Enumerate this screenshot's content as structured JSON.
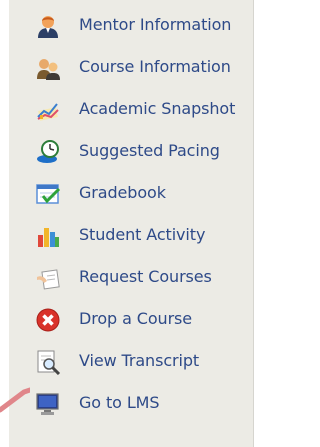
{
  "menu": {
    "items": [
      {
        "label": "Mentor Information",
        "icon": "mentor-person-icon"
      },
      {
        "label": "Course Information",
        "icon": "course-people-icon"
      },
      {
        "label": "Academic Snapshot",
        "icon": "snapshot-chart-icon"
      },
      {
        "label": "Suggested Pacing",
        "icon": "pacing-clock-icon"
      },
      {
        "label": "Gradebook",
        "icon": "gradebook-check-icon"
      },
      {
        "label": "Student Activity",
        "icon": "activity-bar-chart-icon"
      },
      {
        "label": "Request Courses",
        "icon": "request-hand-icon"
      },
      {
        "label": "Drop a Course",
        "icon": "drop-x-icon"
      },
      {
        "label": "View Transcript",
        "icon": "transcript-magnifier-icon"
      },
      {
        "label": "Go to LMS",
        "icon": "lms-monitor-icon"
      }
    ]
  },
  "colors": {
    "panel_background": "#ecebe5",
    "link_text": "#2e4a88",
    "pointer_arrow": "#e0868a"
  }
}
